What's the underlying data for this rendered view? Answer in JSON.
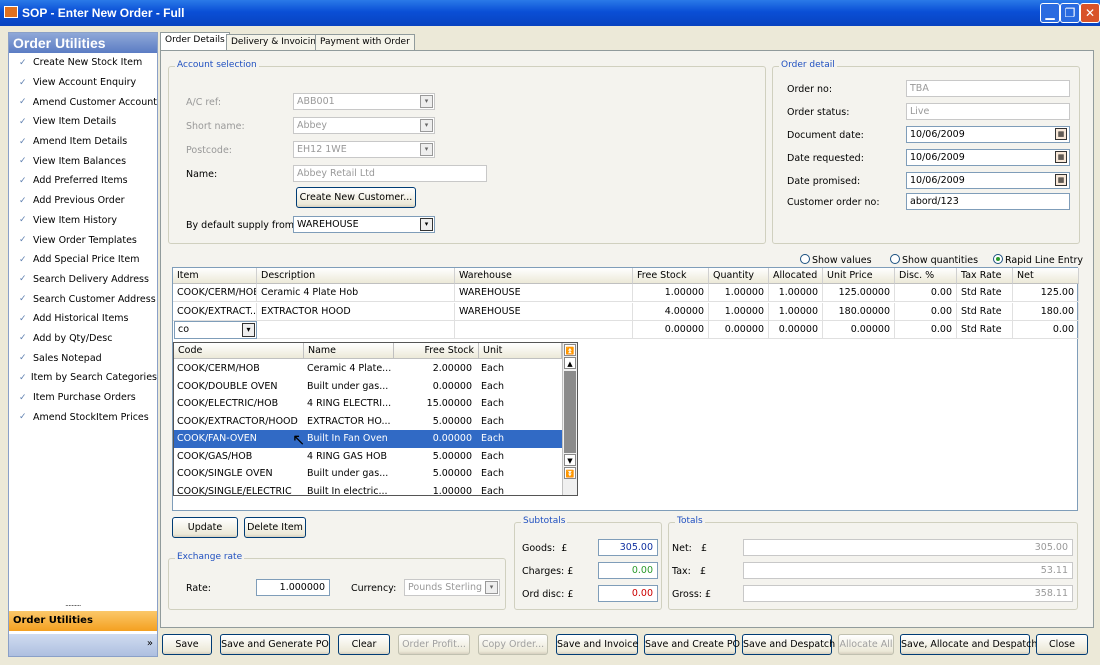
{
  "window": {
    "title": "SOP - Enter New Order - Full"
  },
  "sidebar": {
    "title": "Order Utilities",
    "items": [
      {
        "label": "Create New Stock Item"
      },
      {
        "label": "View Account Enquiry"
      },
      {
        "label": "Amend Customer Account"
      },
      {
        "label": "View Item Details"
      },
      {
        "label": "Amend Item Details"
      },
      {
        "label": "View Item Balances"
      },
      {
        "label": "Add Preferred Items"
      },
      {
        "label": "Add Previous Order"
      },
      {
        "label": "View Item History"
      },
      {
        "label": "View Order Templates"
      },
      {
        "label": "Add Special Price Item"
      },
      {
        "label": "Search Delivery Address"
      },
      {
        "label": "Search Customer Address"
      },
      {
        "label": "Add Historical Items"
      },
      {
        "label": "Add by Qty/Desc"
      },
      {
        "label": "Sales Notepad"
      },
      {
        "label": "Item by Search Categories"
      },
      {
        "label": "Item Purchase Orders"
      },
      {
        "label": "Amend StockItem Prices"
      }
    ],
    "grip": "..........",
    "footer_label": "Order Utilities"
  },
  "tabs": [
    {
      "label": "Order Details"
    },
    {
      "label": "Delivery & Invoicing"
    },
    {
      "label": "Payment with Order"
    }
  ],
  "account": {
    "legend": "Account selection",
    "ac_ref_label": "A/C ref:",
    "ac_ref_value": "ABB001",
    "short_name_label": "Short name:",
    "short_name_value": "Abbey",
    "postcode_label": "Postcode:",
    "postcode_value": "EH12 1WE",
    "name_label": "Name:",
    "name_value": "Abbey Retail Ltd",
    "create_customer_button": "Create New Customer...",
    "supply_label": "By default supply from:",
    "supply_value": "WAREHOUSE"
  },
  "order_detail": {
    "legend": "Order detail",
    "order_no_label": "Order no:",
    "order_no_value": "TBA",
    "status_label": "Order status:",
    "status_value": "Live",
    "doc_date_label": "Document date:",
    "doc_date_value": "10/06/2009",
    "requested_label": "Date requested:",
    "requested_value": "10/06/2009",
    "promised_label": "Date promised:",
    "promised_value": "10/06/2009",
    "cust_order_label": "Customer order no:",
    "cust_order_value": "abord/123"
  },
  "view_options": {
    "show_values": "Show values",
    "show_quantities": "Show quantities",
    "rapid_entry": "Rapid Line Entry"
  },
  "grid": {
    "headers": [
      "Item",
      "Description",
      "Warehouse",
      "Free Stock",
      "Quantity",
      "Allocated",
      "Unit Price",
      "Disc. %",
      "Tax Rate",
      "Net"
    ],
    "rows": [
      [
        "COOK/CERM/HOB",
        "Ceramic 4 Plate Hob",
        "WAREHOUSE",
        "1.00000",
        "1.00000",
        "1.00000",
        "125.00000",
        "0.00",
        "Std Rate",
        "125.00"
      ],
      [
        "COOK/EXTRACT...",
        "EXTRACTOR HOOD",
        "WAREHOUSE",
        "4.00000",
        "1.00000",
        "1.00000",
        "180.00000",
        "0.00",
        "Std Rate",
        "180.00"
      ],
      [
        "",
        "",
        "",
        "0.00000",
        "0.00000",
        "0.00000",
        "0.00000",
        "0.00",
        "Std Rate",
        "0.00"
      ]
    ],
    "input_value": "co"
  },
  "dropdown": {
    "headers": [
      "Code",
      "Name",
      "Free Stock",
      "Unit"
    ],
    "rows": [
      [
        "COOK/CERM/HOB",
        "Ceramic 4 Plate...",
        "2.00000",
        "Each"
      ],
      [
        "COOK/DOUBLE OVEN",
        "Built under gas...",
        "0.00000",
        "Each"
      ],
      [
        "COOK/ELECTRIC/HOB",
        "4 RING ELECTRI...",
        "15.00000",
        "Each"
      ],
      [
        "COOK/EXTRACTOR/HOOD",
        "EXTRACTOR HO...",
        "5.00000",
        "Each"
      ],
      [
        "COOK/FAN-OVEN",
        "Built In Fan Oven",
        "0.00000",
        "Each"
      ],
      [
        "COOK/GAS/HOB",
        "4 RING GAS HOB",
        "5.00000",
        "Each"
      ],
      [
        "COOK/SINGLE OVEN",
        "Built under gas...",
        "5.00000",
        "Each"
      ],
      [
        "COOK/SINGLE/ELECTRIC",
        "Built In electric...",
        "1.00000",
        "Each"
      ]
    ],
    "selected_index": 4
  },
  "line_buttons": {
    "update": "Update",
    "delete": "Delete Item"
  },
  "exchange": {
    "legend": "Exchange rate",
    "rate_label": "Rate:",
    "rate_value": "1.000000",
    "currency_label": "Currency:",
    "currency_value": "Pounds Sterling"
  },
  "subtotals": {
    "legend": "Subtotals",
    "goods_label": "Goods:",
    "goods_value": "305.00",
    "charges_label": "Charges:",
    "charges_value": "0.00",
    "disc_label": "Ord disc:",
    "disc_value": "0.00",
    "currency": "£"
  },
  "totals": {
    "legend": "Totals",
    "net_label": "Net:",
    "net_value": "305.00",
    "tax_label": "Tax:",
    "tax_value": "53.11",
    "gross_label": "Gross:",
    "gross_value": "358.11",
    "currency": "£"
  },
  "colors": {
    "charges_text": "#2a9a2a",
    "disc_text": "#cc0000",
    "selection": "#316ac5",
    "goods_text": "#1030a0"
  },
  "footer_buttons": {
    "save": "Save",
    "save_po": "Save and Generate PO",
    "clear": "Clear",
    "order_profit": "Order Profit...",
    "copy_order": "Copy Order...",
    "save_invoice": "Save and Invoice",
    "save_create_po": "Save and Create PO",
    "save_despatch": "Save and Despatch",
    "allocate_all": "Allocate All",
    "save_alloc_despatch": "Save, Allocate and Despatch",
    "close": "Close"
  }
}
